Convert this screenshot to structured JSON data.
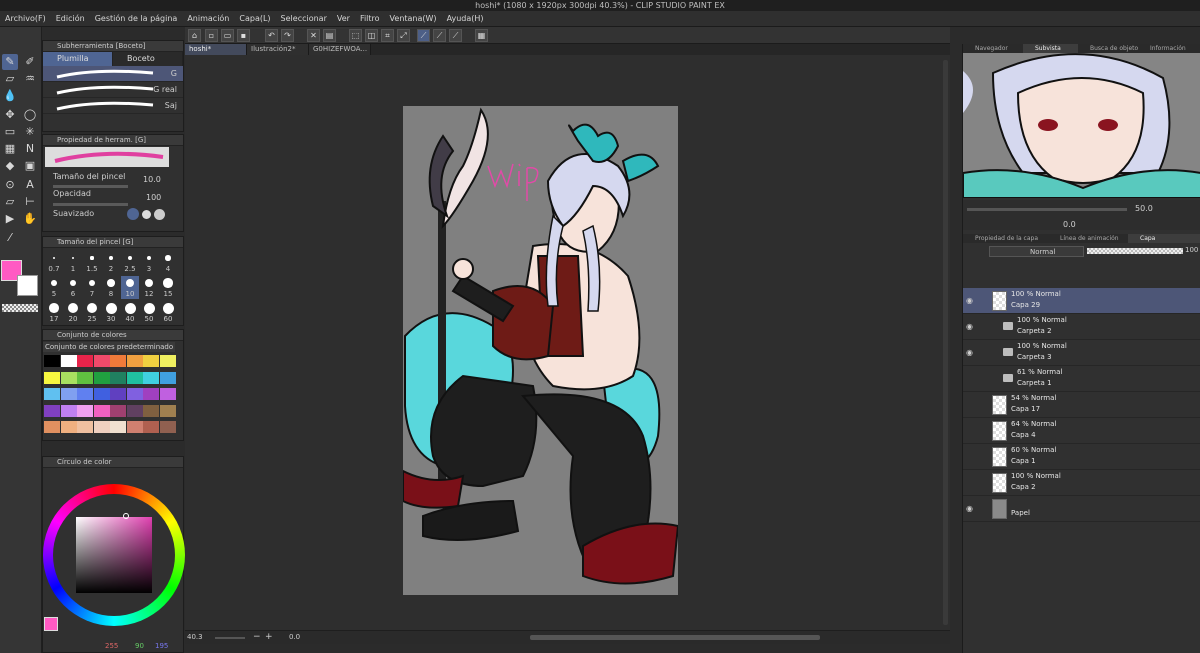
{
  "window": {
    "title": "hoshi* (1080 x 1920px 300dpi 40.3%) - CLIP STUDIO PAINT EX"
  },
  "menu": [
    "Archivo(F)",
    "Edición",
    "Gestión de la página",
    "Animación",
    "Capa(L)",
    "Seleccionar",
    "Ver",
    "Filtro",
    "Ventana(W)",
    "Ayuda(H)"
  ],
  "doc_tabs": [
    "hoshi*",
    "Ilustración2*",
    "G0HIZEFWOA..."
  ],
  "subtool": {
    "title": "Subherramienta [Boceto]",
    "tabs": [
      "Plumilla",
      "Boceto"
    ],
    "brushes": [
      "G",
      "G real",
      "Saj"
    ]
  },
  "tool_property": {
    "title": "Propiedad de herram. [G]",
    "brush_size_label": "Tamaño del pincel",
    "brush_size_value": "10.0",
    "opacity_label": "Opacidad",
    "opacity_value": "100",
    "smoothing_label": "Suavizado"
  },
  "brush_size_panel": {
    "title": "Tamaño del pincel [G]",
    "sizes": [
      "0.7",
      "1",
      "1.5",
      "2",
      "2.5",
      "3",
      "4",
      "5",
      "6",
      "7",
      "8",
      "10",
      "12",
      "15",
      "17",
      "20",
      "25",
      "30",
      "40",
      "50",
      "60"
    ],
    "selected": "10"
  },
  "color_set": {
    "title": "Conjunto de colores",
    "selected_set": "Conjunto de colores predeterminado",
    "swatches": [
      "#000000",
      "#ffffff",
      "#e8244a",
      "#f04a6a",
      "#f07b3a",
      "#f0a040",
      "#f0d040",
      "#f0f060",
      "#f7f740",
      "#a8e060",
      "#60c040",
      "#20a040",
      "#208060",
      "#20c0a0",
      "#40d0e0",
      "#40a0e0",
      "#60c0f0",
      "#80a0f0",
      "#6080f0",
      "#4060e0",
      "#6040c0",
      "#8060e0",
      "#a040c0",
      "#c060e0",
      "#8040c0",
      "#c080f0",
      "#f0a0f0",
      "#f060c0",
      "#a04070",
      "#604060",
      "#806040",
      "#a08050",
      "#e09060",
      "#f0b080",
      "#f0c0a0",
      "#f0d0c0",
      "#f0e0d0",
      "#d08070",
      "#b06050",
      "#906050"
    ]
  },
  "color_wheel": {
    "title": "Círculo de color",
    "rgb": {
      "r": "255",
      "g": "90",
      "b": "195"
    }
  },
  "colors": {
    "main": "#ff5ac3",
    "sub": "#ffffff",
    "accent": "#4f6593"
  },
  "canvas": {
    "zoom": "40.3",
    "rotation": "0.0",
    "art_text": "wip"
  },
  "navigator": {
    "tabs": [
      "Navegador",
      "Subvista",
      "Busca de objeto",
      "Información"
    ],
    "zoom": "50.0",
    "angle": "0.0"
  },
  "layer_panel": {
    "tabs": [
      "Propiedad de la capa",
      "Línea de animación",
      "Capa"
    ],
    "blend_mode": "Normal",
    "opacity": "100",
    "layers": [
      {
        "mode": "100 % Normal",
        "name": "Capa 29",
        "type": "layer",
        "visible": true,
        "selected": true
      },
      {
        "mode": "100 % Normal",
        "name": "Carpeta 2",
        "type": "folder",
        "visible": true,
        "selected": false
      },
      {
        "mode": "100 % Normal",
        "name": "Carpeta 3",
        "type": "folder",
        "visible": true,
        "selected": false
      },
      {
        "mode": "61 % Normal",
        "name": "Carpeta 1",
        "type": "folder",
        "visible": false,
        "selected": false
      },
      {
        "mode": "54 % Normal",
        "name": "Capa 17",
        "type": "layer",
        "visible": false,
        "selected": false
      },
      {
        "mode": "64 % Normal",
        "name": "Capa 4",
        "type": "layer",
        "visible": false,
        "selected": false
      },
      {
        "mode": "60 % Normal",
        "name": "Capa 1",
        "type": "layer",
        "visible": false,
        "selected": false
      },
      {
        "mode": "100 % Normal",
        "name": "Capa 2",
        "type": "layer",
        "visible": false,
        "selected": false
      },
      {
        "mode": "",
        "name": "Papel",
        "type": "paper",
        "visible": true,
        "selected": false
      }
    ]
  }
}
